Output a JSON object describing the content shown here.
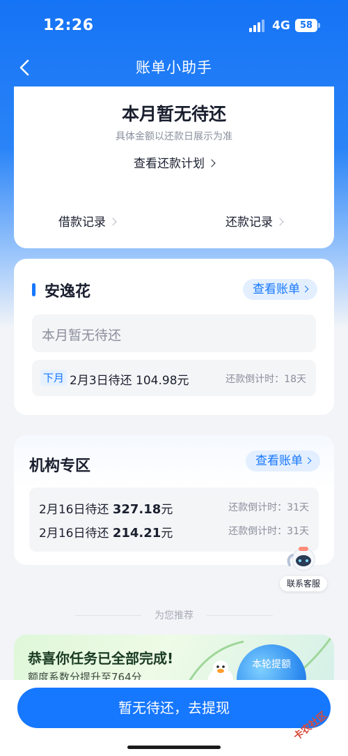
{
  "status_bar": {
    "time": "12:26",
    "network": "4G",
    "battery": "58"
  },
  "nav": {
    "title": "账单小助手"
  },
  "summary": {
    "title": "本月暂无待还",
    "subtitle": "具体金额以还款日展示为准",
    "plan_link": "查看还款计划",
    "borrow_records": "借款记录",
    "repay_records": "还款记录"
  },
  "anyihua": {
    "title": "安逸花",
    "view_bill": "查看账单",
    "no_due_text": "本月暂无待还",
    "next_tag": "下月",
    "due_text": "2月3日待还 104.98元",
    "countdown": "还款倒计时：18天"
  },
  "institution": {
    "title": "机构专区",
    "view_bill": "查看账单",
    "items": [
      {
        "due_prefix": "2月16日待还",
        "amount": "327.18",
        "unit": "元",
        "countdown": "还款倒计时：31天"
      },
      {
        "due_prefix": "2月16日待还",
        "amount": "214.21",
        "unit": "元",
        "countdown": "还款倒计时：31天"
      }
    ]
  },
  "service": {
    "label": "联系客服"
  },
  "recommend": {
    "label": "为您推荐"
  },
  "promo": {
    "title": "恭喜你任务已全部完成!",
    "subtitle": "额度系数分提升至764分",
    "bubble_label": "本轮提额"
  },
  "cta": {
    "label": "暂无待还，去提现"
  },
  "watermark": "卡农社区",
  "colors": {
    "primary": "#1677ff",
    "header": "#1573f5"
  }
}
